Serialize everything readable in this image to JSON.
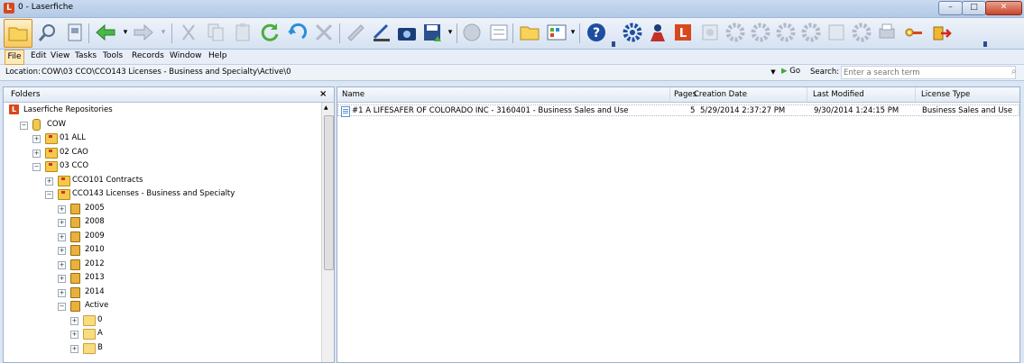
{
  "window": {
    "title": "0 - Laserfiche",
    "app_icon_letter": "L",
    "minimize": "–",
    "maximize": "□",
    "close": "✕"
  },
  "toolbar": {
    "icons": [
      "folder-tree-icon",
      "search-icon",
      "metadata-icon",
      "back-icon",
      "forward-icon",
      "cut-icon",
      "copy-icon",
      "paste-icon",
      "refresh-icon",
      "undo-icon",
      "delete-icon",
      "sign-icon",
      "scan-icon",
      "camera-icon",
      "save-icon",
      "email-icon",
      "list-view-icon",
      "new-folder-icon",
      "thumbnail-view-icon",
      "help-icon",
      "settings-icon",
      "users-icon",
      "laserfiche-icon",
      "workflow-icon",
      "gear-icon",
      "report-icon",
      "records-icon",
      "print-icon",
      "key-icon",
      "logout-icon"
    ]
  },
  "menu": {
    "items": [
      "File",
      "Edit",
      "View",
      "Tasks",
      "Tools",
      "Records",
      "Window",
      "Help"
    ]
  },
  "location": {
    "label": "Location:",
    "path": "COW\\03 CCO\\CCO143 Licenses - Business and Specialty\\Active\\0",
    "go_label": "Go",
    "search_label": "Search:",
    "search_placeholder": "Enter a search term"
  },
  "folders_pane": {
    "title": "Folders",
    "close": "×",
    "tree": [
      {
        "label": "Laserfiche Repositories",
        "level": 0,
        "icon": "repository-icon",
        "expander": ""
      },
      {
        "label": "COW",
        "level": 1,
        "icon": "database-icon",
        "expander": "−"
      },
      {
        "label": "01 ALL",
        "level": 2,
        "icon": "cabinet-icon",
        "expander": "+"
      },
      {
        "label": "02 CAO",
        "level": 2,
        "icon": "cabinet-icon",
        "expander": "+"
      },
      {
        "label": "03 CCO",
        "level": 2,
        "icon": "cabinet-icon",
        "expander": "−"
      },
      {
        "label": "CCO101 Contracts",
        "level": 3,
        "icon": "cabinet-icon",
        "expander": "+"
      },
      {
        "label": "CCO143 Licenses - Business and Specialty",
        "level": 3,
        "icon": "cabinet-icon",
        "expander": "−"
      },
      {
        "label": "2005",
        "level": 4,
        "icon": "binder-icon",
        "expander": "+"
      },
      {
        "label": "2008",
        "level": 4,
        "icon": "binder-icon",
        "expander": "+"
      },
      {
        "label": "2009",
        "level": 4,
        "icon": "binder-icon",
        "expander": "+"
      },
      {
        "label": "2010",
        "level": 4,
        "icon": "binder-icon",
        "expander": "+"
      },
      {
        "label": "2012",
        "level": 4,
        "icon": "binder-icon",
        "expander": "+"
      },
      {
        "label": "2013",
        "level": 4,
        "icon": "binder-icon",
        "expander": "+"
      },
      {
        "label": "2014",
        "level": 4,
        "icon": "binder-icon",
        "expander": "+"
      },
      {
        "label": "Active",
        "level": 4,
        "icon": "binder-icon",
        "expander": "−"
      },
      {
        "label": "0",
        "level": 5,
        "icon": "folder-icon",
        "expander": "+"
      },
      {
        "label": "A",
        "level": 5,
        "icon": "folder-icon",
        "expander": "+"
      },
      {
        "label": "B",
        "level": 5,
        "icon": "folder-icon",
        "expander": "+"
      }
    ]
  },
  "files_pane": {
    "columns": {
      "name": "Name",
      "pages": "Pages",
      "created": "Creation Date",
      "modified": "Last Modified",
      "license": "License Type"
    },
    "rows": [
      {
        "name": "#1 A LIFESAFER OF COLORADO INC  - 3160401 - Business Sales and Use",
        "pages": "5",
        "created": "5/29/2014 2:37:27 PM",
        "modified": "9/30/2014 1:24:15 PM",
        "license": "Business Sales and Use"
      }
    ]
  }
}
